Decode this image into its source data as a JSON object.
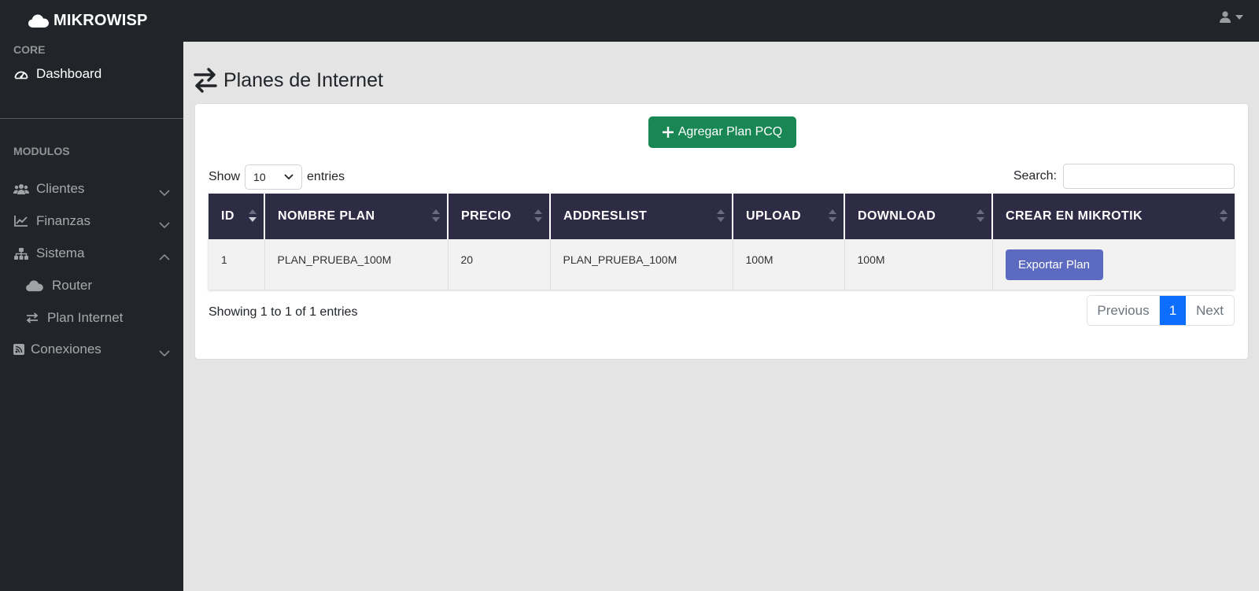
{
  "brand": {
    "name": "MIKROWISP"
  },
  "sidebar": {
    "core_heading": "CORE",
    "dashboard": "Dashboard",
    "modulos_heading": "MODULOS",
    "items": [
      {
        "label": "Clientes",
        "icon": "users-icon"
      },
      {
        "label": "Finanzas",
        "icon": "chart-line-icon"
      },
      {
        "label": "Sistema",
        "icon": "sitemap-icon"
      },
      {
        "label": "Router",
        "icon": "cloud-icon"
      },
      {
        "label": "Plan Internet",
        "icon": "exchange-icon"
      },
      {
        "label": "Conexiones",
        "icon": "rss-icon"
      }
    ]
  },
  "page": {
    "title": "Planes de Internet"
  },
  "actions": {
    "add_plan": "Agregar Plan PCQ"
  },
  "table_controls": {
    "show_label": "Show",
    "entries_label": "entries",
    "page_size": "10",
    "search_label": "Search:"
  },
  "table": {
    "headers": [
      "ID",
      "NOMBRE PLAN",
      "PRECIO",
      "ADDRESLIST",
      "UPLOAD",
      "DOWNLOAD",
      "CREAR EN MIKROTIK"
    ],
    "rows": [
      {
        "id": "1",
        "nombre": "PLAN_PRUEBA_100M",
        "precio": "20",
        "addreslist": "PLAN_PRUEBA_100M",
        "upload": "100M",
        "download": "100M",
        "action": "Exportar Plan"
      }
    ]
  },
  "footer": {
    "info": "Showing 1 to 1 of 1 entries",
    "previous": "Previous",
    "page": "1",
    "next": "Next"
  },
  "colors": {
    "sidebar_bg": "#212529",
    "table_header_bg": "#2e2b45",
    "add_button": "#198754",
    "export_button": "#5c6bc0",
    "active_page": "#0d6efd"
  }
}
